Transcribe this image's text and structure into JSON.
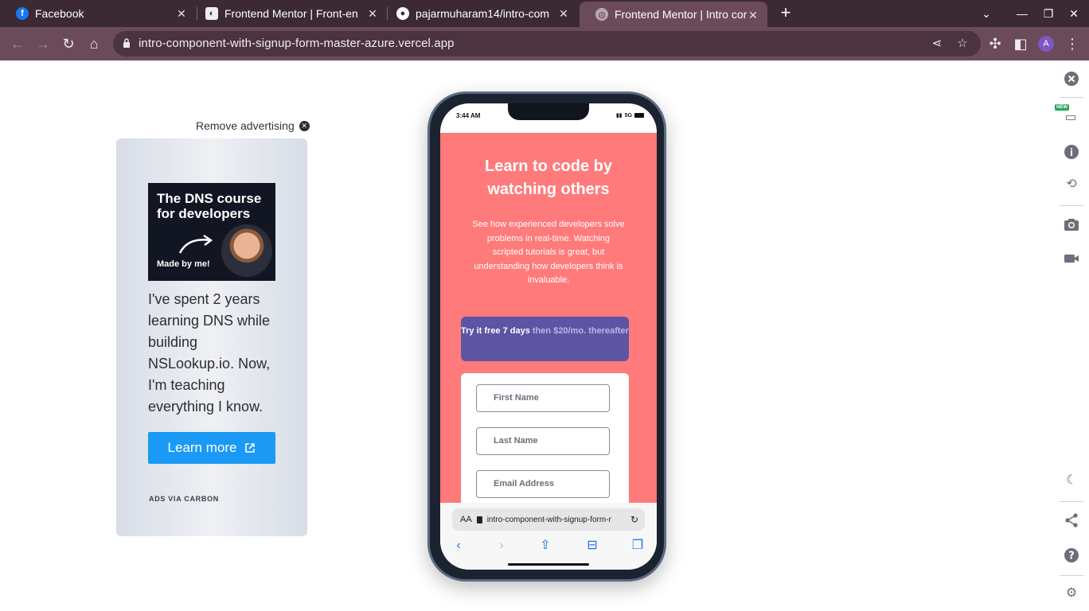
{
  "browser": {
    "tabs": [
      {
        "title": "Facebook",
        "favicon": "facebook-icon",
        "active": false
      },
      {
        "title": "Frontend Mentor | Front-en",
        "favicon": "frontend-mentor-icon",
        "active": false
      },
      {
        "title": "pajarmuharam14/intro-com",
        "favicon": "github-icon",
        "active": false
      },
      {
        "title": "Frontend Mentor | Intro cor",
        "favicon": "globe-icon",
        "active": true
      }
    ],
    "url": "intro-component-with-signup-form-master-azure.vercel.app",
    "profile_initial": "A"
  },
  "ad": {
    "remove_label": "Remove advertising",
    "image_headline": "The DNS course for developers",
    "image_caption": "Made by me!",
    "text": "I've spent 2 years learning DNS while building NSLookup.io. Now, I'm teaching everything I know.",
    "button_label": "Learn more",
    "footer": "ADS VIA CARBON"
  },
  "phone": {
    "status_time": "3:44 AM",
    "status_network": "5G",
    "page": {
      "title": "Learn to code by watching others",
      "description": "See how experienced developers solve problems in real-time. Watching scripted tutorials is great, but understanding how developers think is invaluable.",
      "trial_bold": "Try it free 7 days",
      "trial_rest": "then $20/mo. thereafter",
      "fields": [
        "First Name",
        "Last Name",
        "Email Address"
      ]
    },
    "safari": {
      "aa": "AA",
      "url": "intro-component-with-signup-form-r"
    }
  },
  "side_panel": {
    "new_badge": "NEW"
  },
  "colors": {
    "page_bg": "#ff7a7a",
    "trial_bg": "#5e54a4",
    "ad_button": "#1a9af5",
    "browser_frame": "#6b4a5a"
  }
}
